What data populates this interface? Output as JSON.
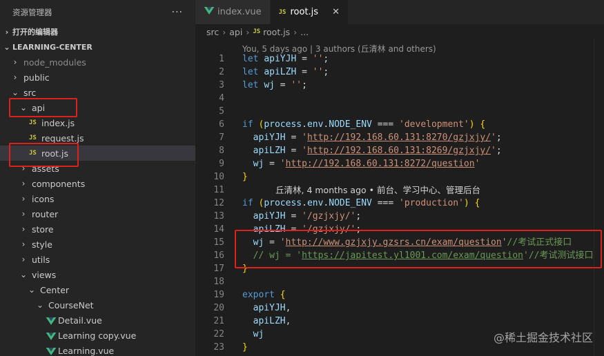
{
  "sidebar": {
    "title": "资源管理器",
    "more": "···",
    "open_editors": "打开的编辑器",
    "project": "LEARNING-CENTER",
    "tree": [
      {
        "label": "node_modules",
        "chev": "›",
        "indent": 1,
        "dim": true
      },
      {
        "label": "public",
        "chev": "›",
        "indent": 1
      },
      {
        "label": "src",
        "chev": "⌄",
        "indent": 1
      },
      {
        "label": "api",
        "chev": "⌄",
        "indent": 2
      },
      {
        "label": "index.js",
        "type": "js",
        "indent": 3
      },
      {
        "label": "request.js",
        "type": "js",
        "indent": 3
      },
      {
        "label": "root.js",
        "type": "js",
        "indent": 3,
        "selected": true
      },
      {
        "label": "assets",
        "chev": "›",
        "indent": 2
      },
      {
        "label": "components",
        "chev": "›",
        "indent": 2
      },
      {
        "label": "icons",
        "chev": "›",
        "indent": 2
      },
      {
        "label": "router",
        "chev": "›",
        "indent": 2
      },
      {
        "label": "store",
        "chev": "›",
        "indent": 2
      },
      {
        "label": "style",
        "chev": "›",
        "indent": 2
      },
      {
        "label": "utils",
        "chev": "›",
        "indent": 2
      },
      {
        "label": "views",
        "chev": "⌄",
        "indent": 2
      },
      {
        "label": "Center",
        "chev": "⌄",
        "indent": 3
      },
      {
        "label": "CourseNet",
        "chev": "⌄",
        "indent": 4
      },
      {
        "label": "Detail.vue",
        "type": "vue",
        "indent": 5
      },
      {
        "label": "Learning copy.vue",
        "type": "vue",
        "indent": 5
      },
      {
        "label": "Learning.vue",
        "type": "vue",
        "indent": 5
      }
    ]
  },
  "tabs": [
    {
      "label": "index.vue",
      "icon": "vue-icon",
      "active": false
    },
    {
      "label": "root.js",
      "icon": "JS",
      "active": true,
      "close": "✕"
    }
  ],
  "breadcrumb": {
    "parts": [
      "src",
      "api"
    ],
    "file": "root.js",
    "tail": "..."
  },
  "codelens": "You, 5 days ago | 3 authors (丘清林 and others)",
  "blame": "丘清林, 4 months ago • 前台、学习中心、管理后台",
  "code_lines": [
    {
      "n": "1",
      "html": "<span class=\"k\">let</span> <span class=\"v\">apiYJH</span> <span class=\"p\">=</span> <span class=\"s\">''</span><span class=\"p\">;</span>"
    },
    {
      "n": "2",
      "html": "<span class=\"k\">let</span> <span class=\"v\">apiLZH</span> <span class=\"p\">=</span> <span class=\"s\">''</span><span class=\"p\">;</span>"
    },
    {
      "n": "3",
      "html": "<span class=\"k\">let</span> <span class=\"v\">wj</span> <span class=\"p\">=</span> <span class=\"s\">''</span><span class=\"p\">;</span>"
    },
    {
      "n": "4",
      "html": ""
    },
    {
      "n": "5",
      "html": ""
    },
    {
      "n": "6",
      "html": "<span class=\"k\">if</span> <span class=\"b\">(</span><span class=\"v\">process</span>.<span class=\"v\">env</span>.<span class=\"v\">NODE_ENV</span> <span class=\"p\">===</span> <span class=\"s\">'development'</span><span class=\"b\">)</span> <span class=\"b\">{</span>"
    },
    {
      "n": "7",
      "html": "  <span class=\"v\">apiYJH</span> = <span class=\"s\">'</span><span class=\"u\">http://192.168.60.131:8270/gzjxjy/</span><span class=\"s\">'</span>;"
    },
    {
      "n": "8",
      "html": "  <span class=\"v\">apiLZH</span> = <span class=\"s\">'</span><span class=\"u\">http://192.168.60.131:8269/gzjxjy/</span><span class=\"s\">'</span>;"
    },
    {
      "n": "9",
      "html": "  <span class=\"v\">wj</span> = <span class=\"s\">'</span><span class=\"u\">http://192.168.60.131:8272/question</span><span class=\"s\">'</span>"
    },
    {
      "n": "10",
      "html": "<span class=\"b\">}</span>"
    },
    {
      "n": "11",
      "blame": true
    },
    {
      "n": "12",
      "html": "<span class=\"k\">if</span> <span class=\"b\">(</span><span class=\"v\">process</span>.<span class=\"v\">env</span>.<span class=\"v\">NODE_ENV</span> <span class=\"p\">===</span> <span class=\"s\">'production'</span><span class=\"b\">)</span> <span class=\"b\">{</span>"
    },
    {
      "n": "13",
      "html": "  <span class=\"v\">apiYJH</span> = <span class=\"s\">'/gzjxjy/'</span>;"
    },
    {
      "n": "14",
      "html": "  <span class=\"v\">apiLZH</span> = <span class=\"s\">'/gzjxjy/'</span>;"
    },
    {
      "n": "15",
      "html": "  <span class=\"v\">wj</span> = <span class=\"s\">'</span><span class=\"u\">http://www.gzjxjy.gzsrs.cn/exam/question</span><span class=\"s\">'</span><span class=\"c\">//<span class=\"zh\">考试正式接口</span></span>"
    },
    {
      "n": "16",
      "html": "  <span class=\"c\">// wj = '<span style=\"text-decoration:underline\">https://japitest.yl1001.com/exam/question</span>'//<span class=\"zh\">考试测试接口</span></span>"
    },
    {
      "n": "17",
      "html": "<span class=\"b\">}</span>"
    },
    {
      "n": "18",
      "html": ""
    },
    {
      "n": "19",
      "html": "<span class=\"k\">export</span> <span class=\"b\">{</span>"
    },
    {
      "n": "20",
      "html": "  <span class=\"v\">apiYJH</span>,"
    },
    {
      "n": "21",
      "html": "  <span class=\"v\">apiLZH</span>,"
    },
    {
      "n": "22",
      "html": "  <span class=\"v\">wj</span>"
    },
    {
      "n": "23",
      "html": "<span class=\"b\">}</span>"
    }
  ],
  "watermark": "@稀土掘金技术社区",
  "colors": {
    "accent_red": "#e0201c",
    "js_yellow": "#cbcb41",
    "vue_green": "#41b883"
  }
}
